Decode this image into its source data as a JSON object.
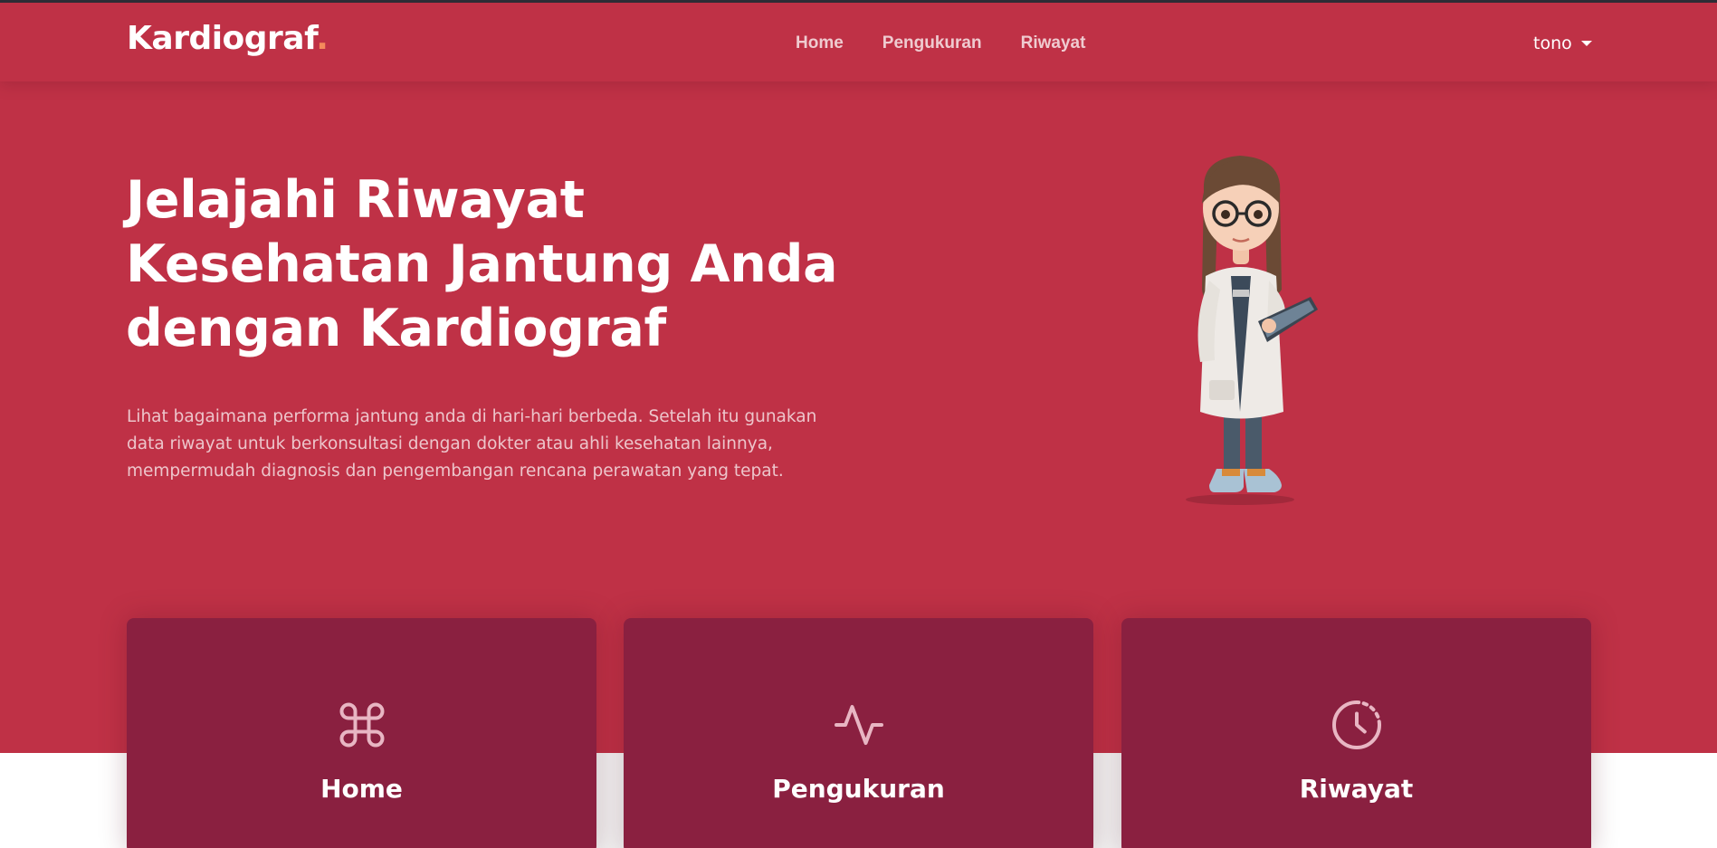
{
  "header": {
    "logo_text": "Kardiograf",
    "logo_dot": ".",
    "nav": [
      {
        "label": "Home"
      },
      {
        "label": "Pengukuran"
      },
      {
        "label": "Riwayat"
      }
    ],
    "user": {
      "name": "tono",
      "icon": "caret-down-icon"
    }
  },
  "hero": {
    "title_lines": [
      "Jelajahi Riwayat",
      "Kesehatan Jantung Anda",
      "dengan Kardiograf"
    ],
    "description_lines": [
      "Lihat bagaimana performa jantung anda di hari-hari berbeda. Setelah itu gunakan",
      "data riwayat untuk berkonsultasi dengan dokter atau ahli kesehatan lainnya,",
      "mempermudah diagnosis dan pengembangan rencana perawatan yang tepat."
    ],
    "illustration": "doctor-character-illustration"
  },
  "cards": [
    {
      "title": "Home",
      "icon": "command-icon"
    },
    {
      "title": "Pengukuran",
      "icon": "activity-icon"
    },
    {
      "title": "Riwayat",
      "icon": "clock-icon"
    }
  ],
  "colors": {
    "primary": "#bf3146",
    "card": "#8a2040",
    "logo_dot": "#f58a5c",
    "text": "#ffffff"
  }
}
